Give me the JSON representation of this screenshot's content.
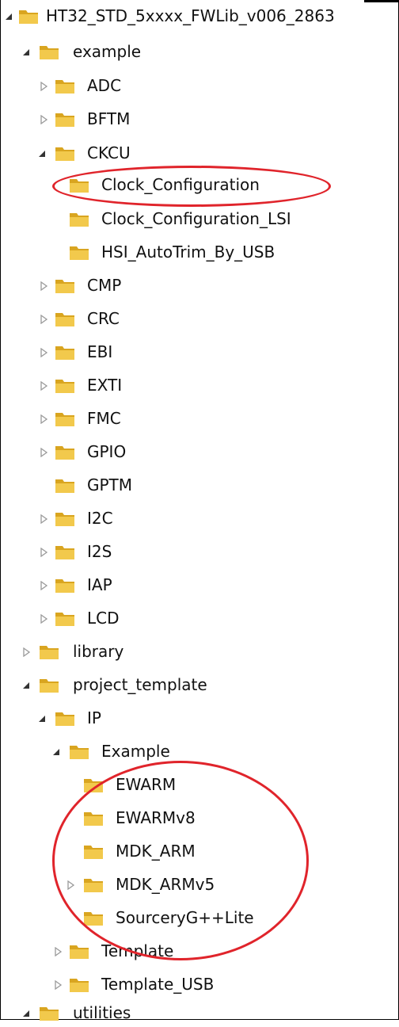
{
  "tree": {
    "root": {
      "label": "HT32_STD_5xxxx_FWLib_v006_2863",
      "state": "expanded"
    },
    "items": [
      {
        "label": "example",
        "state": "expanded"
      },
      {
        "label": "ADC",
        "state": "collapsed"
      },
      {
        "label": "BFTM",
        "state": "collapsed"
      },
      {
        "label": "CKCU",
        "state": "expanded"
      },
      {
        "label": "Clock_Configuration",
        "state": "leaf",
        "highlighted": true
      },
      {
        "label": "Clock_Configuration_LSI",
        "state": "leaf"
      },
      {
        "label": "HSI_AutoTrim_By_USB",
        "state": "leaf"
      },
      {
        "label": "CMP",
        "state": "collapsed"
      },
      {
        "label": "CRC",
        "state": "collapsed"
      },
      {
        "label": "EBI",
        "state": "collapsed"
      },
      {
        "label": "EXTI",
        "state": "collapsed"
      },
      {
        "label": "FMC",
        "state": "collapsed"
      },
      {
        "label": "GPIO",
        "state": "collapsed"
      },
      {
        "label": "GPTM",
        "state": "leaf"
      },
      {
        "label": "I2C",
        "state": "collapsed"
      },
      {
        "label": "I2S",
        "state": "collapsed"
      },
      {
        "label": "IAP",
        "state": "collapsed"
      },
      {
        "label": "LCD",
        "state": "collapsed"
      },
      {
        "label": "library",
        "state": "collapsed"
      },
      {
        "label": "project_template",
        "state": "expanded"
      },
      {
        "label": "IP",
        "state": "expanded"
      },
      {
        "label": "Example",
        "state": "expanded"
      },
      {
        "label": "EWARM",
        "state": "leaf"
      },
      {
        "label": "EWARMv8",
        "state": "leaf"
      },
      {
        "label": "MDK_ARM",
        "state": "leaf"
      },
      {
        "label": "MDK_ARMv5",
        "state": "collapsed"
      },
      {
        "label": "SourceryG++Lite",
        "state": "leaf"
      },
      {
        "label": "Template",
        "state": "collapsed"
      },
      {
        "label": "Template_USB",
        "state": "collapsed"
      },
      {
        "label": "utilities",
        "state": "expanded"
      }
    ]
  },
  "colors": {
    "highlight_ring": "#e0242b",
    "folder_front": "#f2c94c",
    "folder_back": "#d9a520",
    "arrow_expanded": "#333333",
    "arrow_collapsed": "#9a9a9a"
  }
}
